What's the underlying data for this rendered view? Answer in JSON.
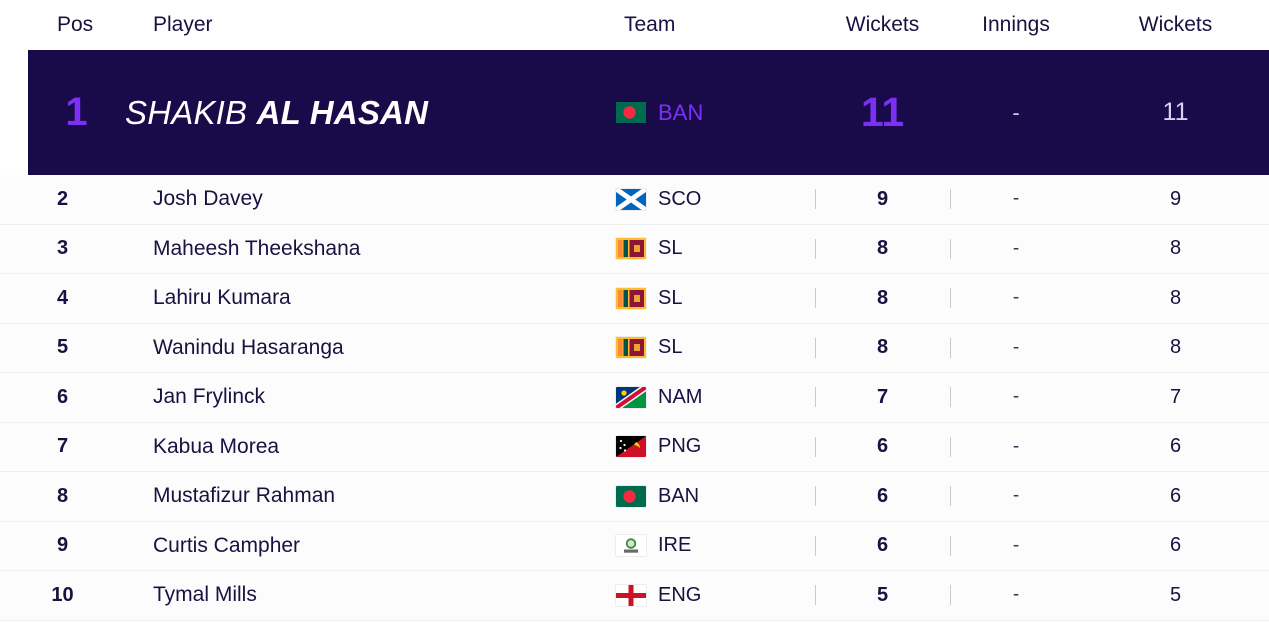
{
  "table": {
    "columns": [
      "Pos",
      "Player",
      "Team",
      "Wickets",
      "Innings",
      "Wickets"
    ],
    "featured": {
      "pos": "1",
      "player_first": "SHAKIB",
      "player_last": "AL HASAN",
      "team_code": "BAN",
      "team_flag": "bangladesh-flag",
      "wickets": "11",
      "innings": "-",
      "wickets_total": "11"
    },
    "rows": [
      {
        "pos": "2",
        "player": "Josh Davey",
        "team_code": "SCO",
        "team_flag": "scotland-flag",
        "wickets": "9",
        "innings": "-",
        "wickets_total": "9"
      },
      {
        "pos": "3",
        "player": "Maheesh Theekshana",
        "team_code": "SL",
        "team_flag": "srilanka-flag",
        "wickets": "8",
        "innings": "-",
        "wickets_total": "8"
      },
      {
        "pos": "4",
        "player": "Lahiru Kumara",
        "team_code": "SL",
        "team_flag": "srilanka-flag",
        "wickets": "8",
        "innings": "-",
        "wickets_total": "8"
      },
      {
        "pos": "5",
        "player": "Wanindu Hasaranga",
        "team_code": "SL",
        "team_flag": "srilanka-flag",
        "wickets": "8",
        "innings": "-",
        "wickets_total": "8"
      },
      {
        "pos": "6",
        "player": "Jan Frylinck",
        "team_code": "NAM",
        "team_flag": "namibia-flag",
        "wickets": "7",
        "innings": "-",
        "wickets_total": "7"
      },
      {
        "pos": "7",
        "player": "Kabua Morea",
        "team_code": "PNG",
        "team_flag": "png-flag",
        "wickets": "6",
        "innings": "-",
        "wickets_total": "6"
      },
      {
        "pos": "8",
        "player": "Mustafizur Rahman",
        "team_code": "BAN",
        "team_flag": "bangladesh-flag",
        "wickets": "6",
        "innings": "-",
        "wickets_total": "6"
      },
      {
        "pos": "9",
        "player": "Curtis Campher",
        "team_code": "IRE",
        "team_flag": "ireland-crest",
        "wickets": "6",
        "innings": "-",
        "wickets_total": "6"
      },
      {
        "pos": "10",
        "player": "Tymal Mills",
        "team_code": "ENG",
        "team_flag": "england-flag",
        "wickets": "5",
        "innings": "-",
        "wickets_total": "5"
      }
    ]
  },
  "colors": {
    "featured_bg": "#190a4a",
    "accent_purple": "#7c30f5",
    "text_dark": "#1b1040",
    "row_bg": "#fcfcfc",
    "divider": "#efeff3"
  }
}
